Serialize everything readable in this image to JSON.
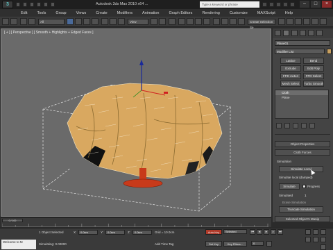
{
  "titlebar": {
    "title": "Autodesk 3ds Max 2010 x64 ...",
    "search_placeholder": "Type a keyword or phrase"
  },
  "menu": {
    "items": [
      "Edit",
      "Tools",
      "Group",
      "Views",
      "Create",
      "Modifiers",
      "Animation",
      "Graph Editors",
      "Rendering",
      "Customize",
      "MAXScript",
      "Help"
    ]
  },
  "toolbar": {
    "filter_dropdown": "All",
    "coord_dropdown": "View",
    "selection_set": "Create Selection Se"
  },
  "viewport": {
    "label": "[ + ] [ Perspective ] [ Smooth + Highlights + Edged Faces ]"
  },
  "command_panel": {
    "object_name": "Plane01",
    "modifier_list": "Modifier List",
    "buttons": [
      "Lattice",
      "Bend",
      "Extrude",
      "Edit Poly",
      "FFD 4x4x4",
      "FFD Select",
      "Mesh Select",
      "Turbo Smooth"
    ],
    "stack": [
      {
        "label": "Cloth",
        "selected": true
      },
      {
        "label": "Plane",
        "selected": false
      }
    ],
    "rollouts": {
      "object_properties": "Object Properties",
      "cloth_forces": "Cloth Forces",
      "simulation_header": "Simulation",
      "simulate_local": "Simulate Local",
      "simulate_local_damped": "Simulate local (damped)",
      "simulate_label": "Simulate",
      "progress_label": "Progress",
      "simulated_frames_label": "Simulated",
      "simulated_frames_value": "1",
      "erase_simulation": "Erase Simulation",
      "truncate_simulation": "Truncate Simulation",
      "selected_object_manip": "Selected Object's Manip"
    }
  },
  "trackbar": {
    "frame_readout": "0 / 100",
    "ticks": [
      "0",
      "10",
      "20",
      "30",
      "40",
      "50",
      "60",
      "70",
      "80",
      "90",
      "100"
    ]
  },
  "statusbar": {
    "selection_info": "1 Object Selected",
    "prompt": "Simulating: 0.00000",
    "x_label": "X:",
    "x_value": "0.0cm",
    "y_label": "Y:",
    "y_value": "0.0cm",
    "z_label": "Z:",
    "z_value": "0.0cm",
    "grid": "Grid = 10.0cm",
    "add_time_tag": "Add Time Tag",
    "auto_key": "Auto Key",
    "set_key": "Set Key",
    "key_filters": "Key Filters...",
    "selected_dropdown": "Selected",
    "current_frame": "0",
    "maxscript_text": "Welcome to M"
  },
  "colors": {
    "cloth": "#d9a860",
    "table_base": "#c83a1a",
    "viewport_bg": "#6a6a6a",
    "gizmo_y": "#1a2a9a"
  }
}
